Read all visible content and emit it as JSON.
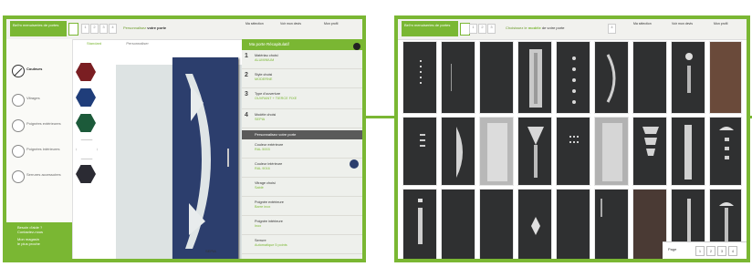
{
  "left_screen": {
    "logo_text": "Bel'm menuiseries de portes",
    "breadcrumb_prefix": "Personnalisez",
    "breadcrumb_highlight": "votre porte",
    "top_nav": [
      "Ma sélection",
      "Voir mon devis",
      "Mon profil"
    ],
    "sidebar": [
      "Couleurs",
      "Vitrages",
      "Poignées extérieures",
      "Poignées intérieures",
      "Serrures accessoires"
    ],
    "phone_lines": [
      "Besoin d'aide ?",
      "Contactez-nous",
      "Mon magasin",
      "le plus proche"
    ],
    "swatch_colors": [
      "#7a1e22",
      "#1f3d7a",
      "#1c5a3a",
      "#ffffff",
      "#2b2b33"
    ],
    "option_labels": [
      "Standard",
      "Personnaliser"
    ],
    "config_title": "Ma porte",
    "config_header_suffix": "Récapitulatif",
    "config_steps": [
      {
        "num": "1",
        "label": "Matériau choisi",
        "value": "ALUMINIUM"
      },
      {
        "num": "2",
        "label": "Style choisi",
        "value": "MODERNE"
      },
      {
        "num": "3",
        "label": "Type d'ouverture",
        "value": "OUVRANT + TIERCE FIXE"
      },
      {
        "num": "4",
        "label": "Modèle choisi",
        "value": "SEPIA"
      }
    ],
    "config_section": "Personnalisez votre porte",
    "config_details": [
      {
        "label": "Couleur extérieure",
        "value": "RAL 5003"
      },
      {
        "label": "Couleur intérieure",
        "value": "RAL 9016"
      },
      {
        "label": "Vitrage choisi",
        "value": "Sablé"
      },
      {
        "label": "Poignée extérieure",
        "value": "Barre inox"
      },
      {
        "label": "Poignée intérieure",
        "value": "Inox"
      },
      {
        "label": "Serrure",
        "value": "Automatique 5 points"
      }
    ],
    "door_label": "SEPIA",
    "door_color": "#2c3e6d"
  },
  "right_screen": {
    "logo_text": "Bel'm menuiseries de portes",
    "breadcrumb_prefix": "Choisissez le",
    "breadcrumb_highlight": "modèle",
    "breadcrumb_suffix": "de votre porte",
    "top_nav": [
      "Ma sélection",
      "Voir mon devis",
      "Mon profil"
    ],
    "pager_label": "Page",
    "pager_buttons": [
      "1",
      "2",
      "3",
      "4"
    ],
    "tile_base_color": "#2f3031",
    "accent_color": "#7ab733"
  }
}
